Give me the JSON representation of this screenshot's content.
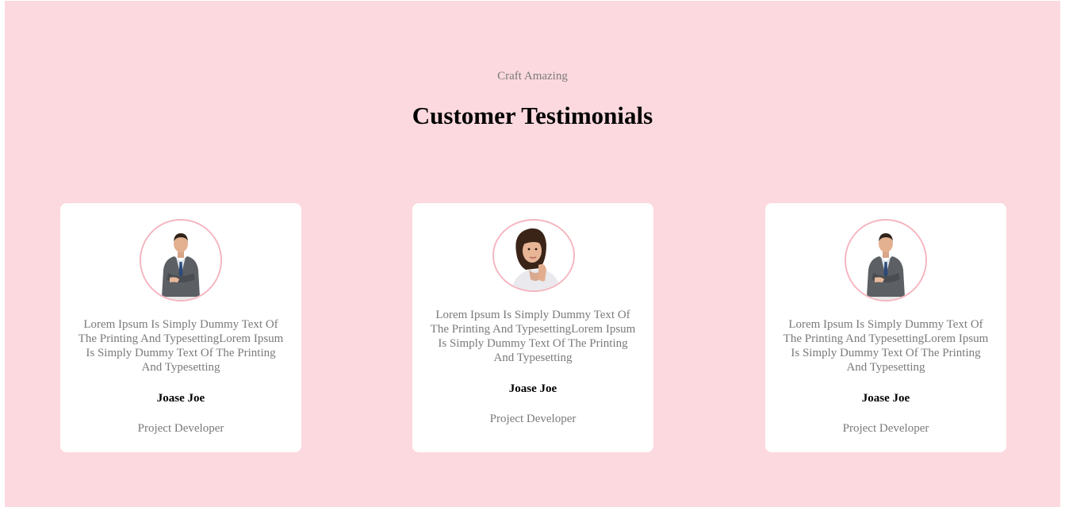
{
  "header": {
    "eyebrow": "Craft Amazing",
    "title": "Customer Testimonials"
  },
  "colors": {
    "background": "#fcd9de",
    "card": "#ffffff",
    "avatar_border": "#f5b5bf",
    "muted_text": "#7a7a7a"
  },
  "testimonials": [
    {
      "avatar": "businessman-photo",
      "quote": "Lorem Ipsum Is Simply Dummy Text Of The Printing And TypesettingLorem Ipsum Is Simply Dummy Text Of The Printing And Typesetting",
      "name": "Joase Joe",
      "role": "Project Developer"
    },
    {
      "avatar": "businesswoman-photo",
      "quote": "Lorem Ipsum Is Simply Dummy Text Of The Printing And TypesettingLorem Ipsum Is Simply Dummy Text Of The Printing And Typesetting",
      "name": "Joase Joe",
      "role": "Project Developer"
    },
    {
      "avatar": "businessman-photo",
      "quote": "Lorem Ipsum Is Simply Dummy Text Of The Printing And TypesettingLorem Ipsum Is Simply Dummy Text Of The Printing And Typesetting",
      "name": "Joase Joe",
      "role": "Project Developer"
    }
  ]
}
